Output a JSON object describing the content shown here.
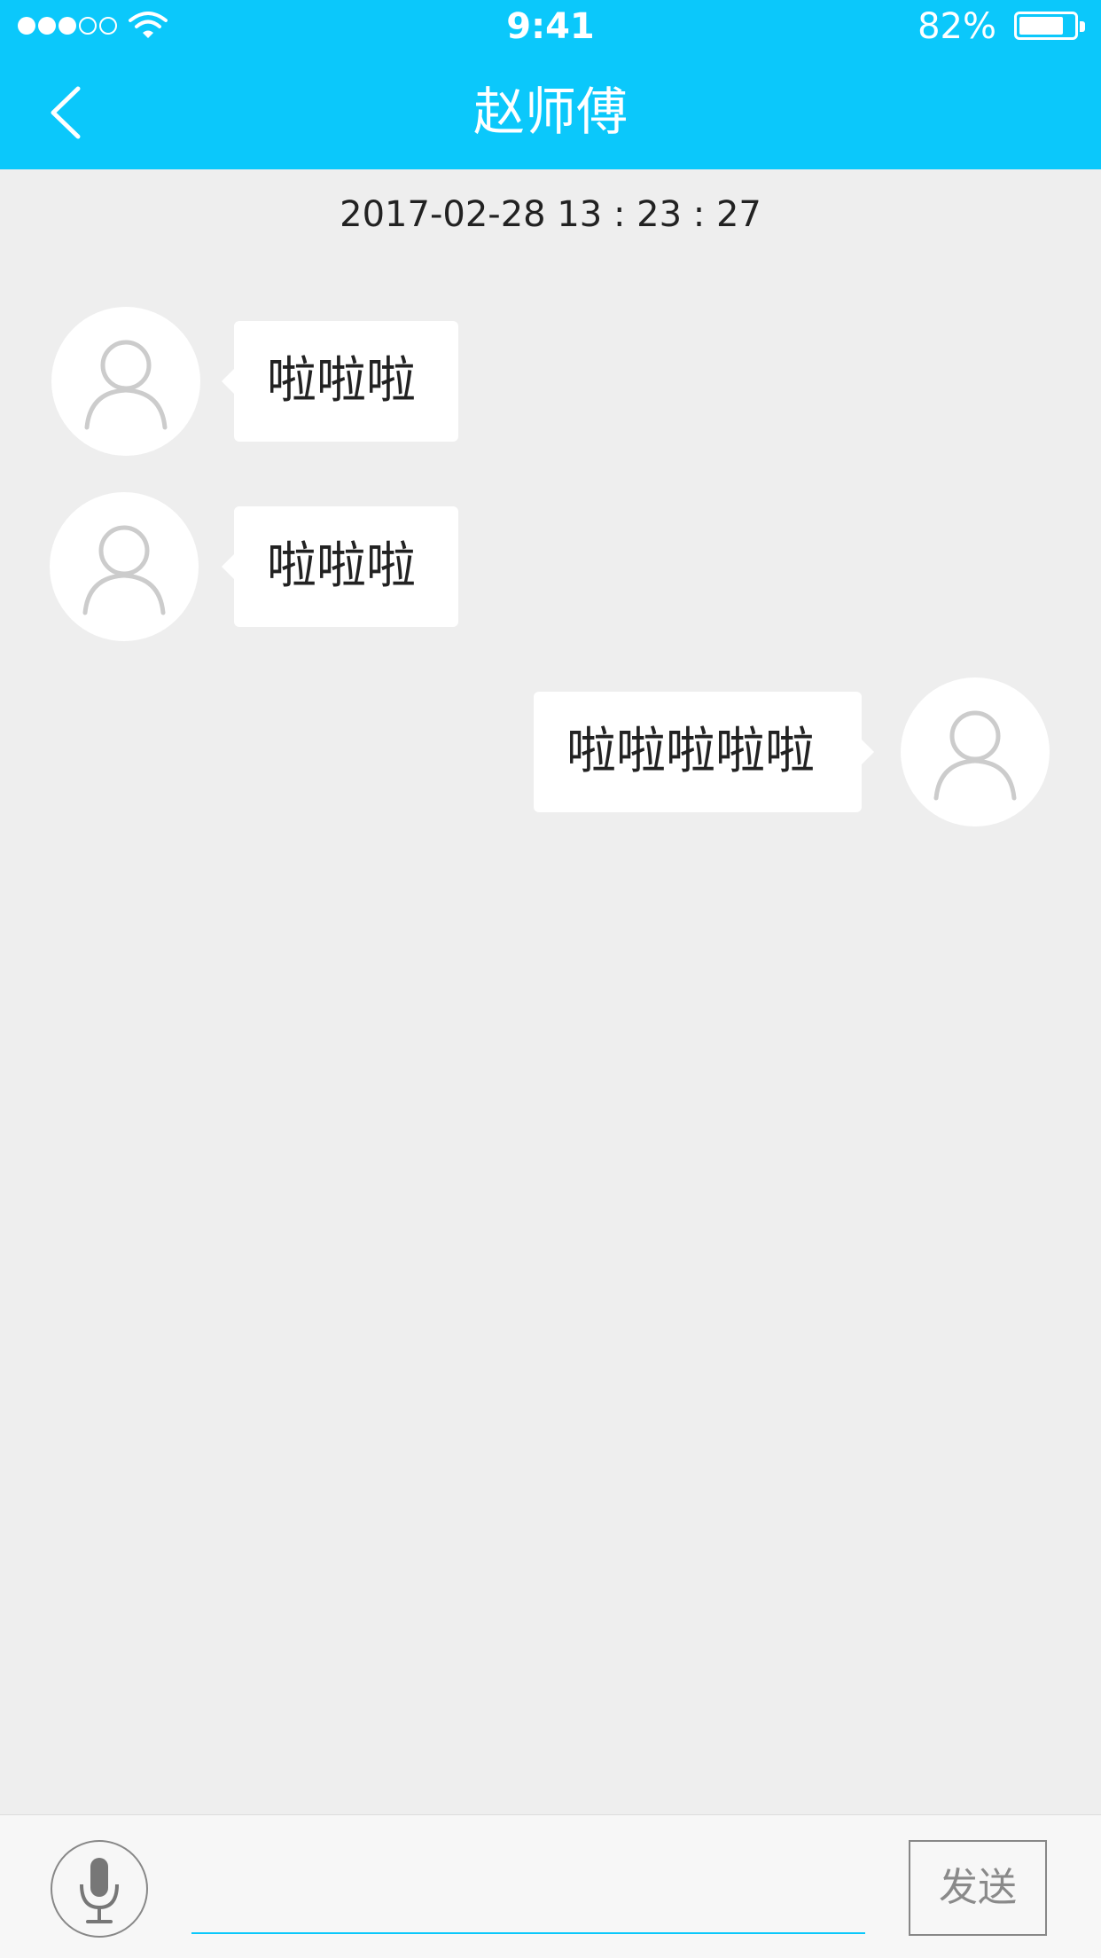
{
  "status_bar": {
    "time": "9:41",
    "battery_percent": "82%",
    "battery_level": 0.82,
    "signal_bars_filled": 3,
    "signal_bars_total": 5
  },
  "header": {
    "title": "赵师傅",
    "back_icon": "chevron-left-icon",
    "background_color": "#0bc8fb"
  },
  "chat": {
    "timestamp": "2017-02-28 13 : 23 : 27",
    "messages": [
      {
        "side": "left",
        "text": "啦啦啦"
      },
      {
        "side": "left",
        "text": "啦啦啦"
      },
      {
        "side": "right",
        "text": "啦啦啦啦啦"
      }
    ]
  },
  "composer": {
    "mic_icon": "microphone-icon",
    "input_value": "",
    "send_label": "发送",
    "accent_color": "#0bc8fb"
  }
}
